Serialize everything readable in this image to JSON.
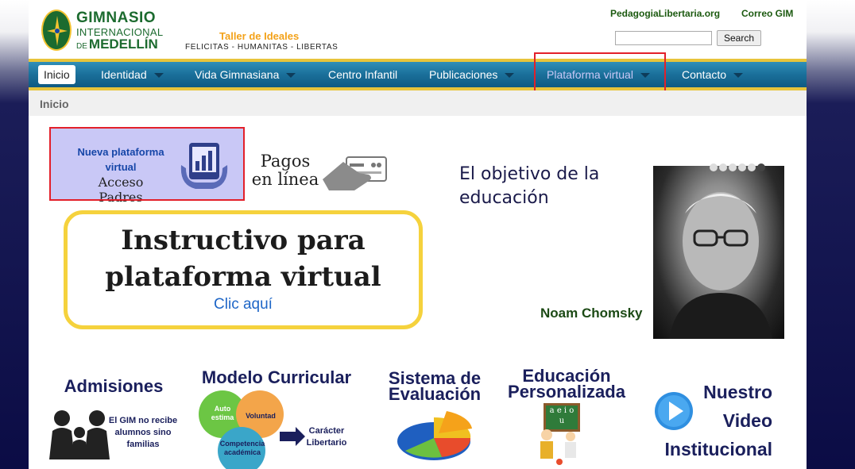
{
  "header": {
    "brand_line1": "GIMNASIO",
    "brand_line2": "INTERNACIONAL",
    "brand_de": "DE",
    "brand_line3": "MEDELLÍN",
    "tagline_title": "Taller de Ideales",
    "tagline_sub": "FELICITAS - HUMANITAS - LIBERTAS",
    "link_pedagogia": "PedagogiaLibertaria.org",
    "link_correo": "Correo GIM",
    "search_placeholder": "",
    "search_button": "Search"
  },
  "nav": {
    "items": [
      {
        "label": "Inicio"
      },
      {
        "label": "Identidad"
      },
      {
        "label": "Vida Gimnasiana"
      },
      {
        "label": "Centro Infantil"
      },
      {
        "label": "Publicaciones"
      },
      {
        "label": "Plataforma virtual"
      },
      {
        "label": "Contacto"
      }
    ],
    "accent": "#1a6f9a",
    "highlight": "#e3202a"
  },
  "breadcrumb": "Inicio",
  "plataforma": {
    "line1": "Nueva plataforma virtual",
    "line2": "Acceso Padres"
  },
  "pagos": {
    "line1": "Pagos",
    "line2": "en línea"
  },
  "instructivo": {
    "title_line1": "Instructivo para",
    "title_line2": "plataforma virtual",
    "link": "Clic aquí"
  },
  "slider": {
    "quote_line1": "El objetivo de la",
    "quote_line2": "educación",
    "author": "Noam Chomsky",
    "slide_count": 6,
    "active_slide": 6
  },
  "cards": {
    "admisiones": {
      "title": "Admisiones",
      "note1": "El GIM no recibe",
      "note2": "alumnos sino",
      "note3": "familias"
    },
    "modelo": {
      "title": "Modelo Curricular",
      "c1a": "Auto",
      "c1b": "estima",
      "c2": "Voluntad",
      "c3a": "Competencia",
      "c3b": "académica",
      "arrow1": "Carácter",
      "arrow2": "Libertario"
    },
    "sistema": {
      "line1": "Sistema de",
      "line2": "Evaluación"
    },
    "educacion": {
      "line1": "Educación",
      "line2": "Personalizada",
      "board": "a e i o u"
    },
    "video": {
      "line1": "Nuestro",
      "line2": "Video",
      "line3": "Institucional"
    }
  }
}
